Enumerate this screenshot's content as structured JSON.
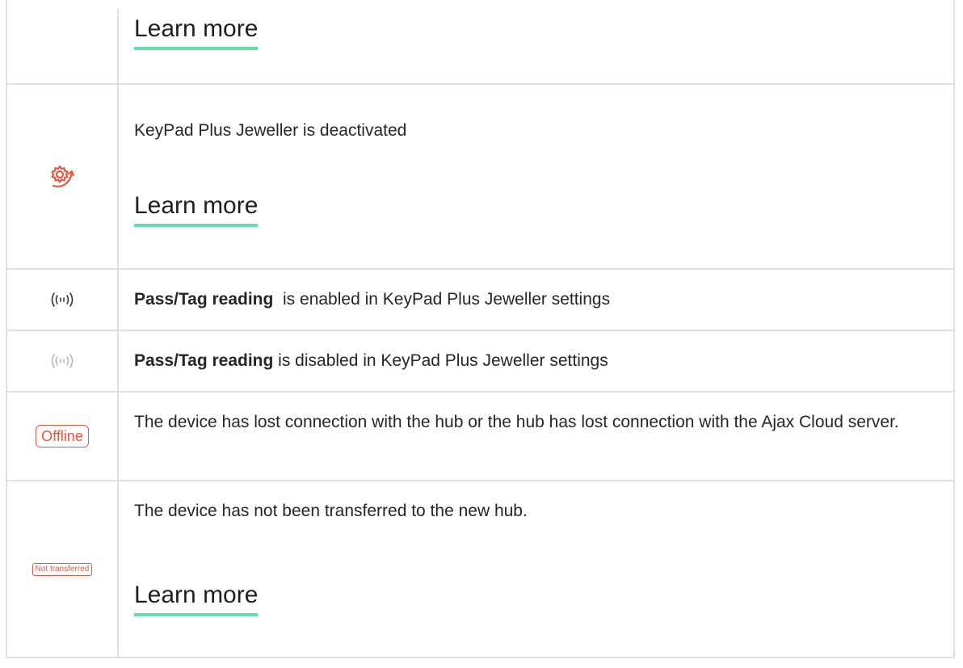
{
  "rows": {
    "top": {
      "link": "Learn more"
    },
    "deactivated": {
      "text": "KeyPad Plus Jeweller is deactivated",
      "link": "Learn more",
      "icon": "gear-arrow-icon"
    },
    "pass_enabled": {
      "bold": "Pass/Tag reading",
      "text": "  is enabled in KeyPad Plus Jeweller settings",
      "icon": "radio-waves-icon"
    },
    "pass_disabled": {
      "bold": "Pass/Tag reading",
      "text": " is disabled in KeyPad Plus Jeweller settings",
      "icon": "radio-waves-icon"
    },
    "offline": {
      "badge": "Offline",
      "text": "The device has lost connection with the hub or the hub has lost connection with the Ajax Cloud server."
    },
    "not_transferred": {
      "badge": "Not transferred",
      "text": "The device has not been transferred to the new hub.",
      "link": "Learn more"
    }
  },
  "colors": {
    "accent_underline": "#5fe0a6",
    "status_red": "#e8553f",
    "icon_dark": "#333333",
    "icon_light": "#b8b8b8",
    "border": "#e0e0e0"
  }
}
